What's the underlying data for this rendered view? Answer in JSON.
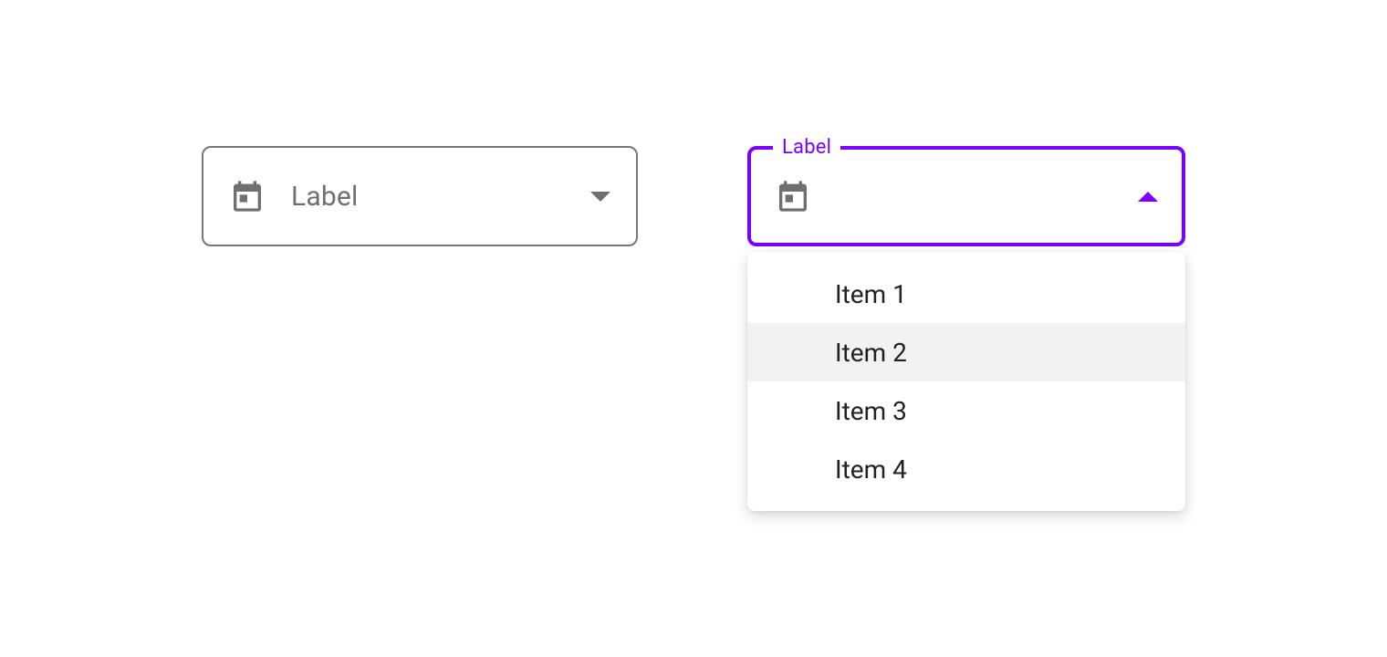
{
  "colors": {
    "accent": "#7b00ff",
    "border_idle": "#767676",
    "text_muted": "#6f6f6f"
  },
  "select_closed": {
    "placeholder": "Label",
    "icon": "calendar-icon"
  },
  "select_open": {
    "floating_label": "Label",
    "icon": "calendar-icon",
    "menu": {
      "hovered_index": 1,
      "items": [
        "Item 1",
        "Item 2",
        "Item 3",
        "Item 4"
      ]
    }
  }
}
